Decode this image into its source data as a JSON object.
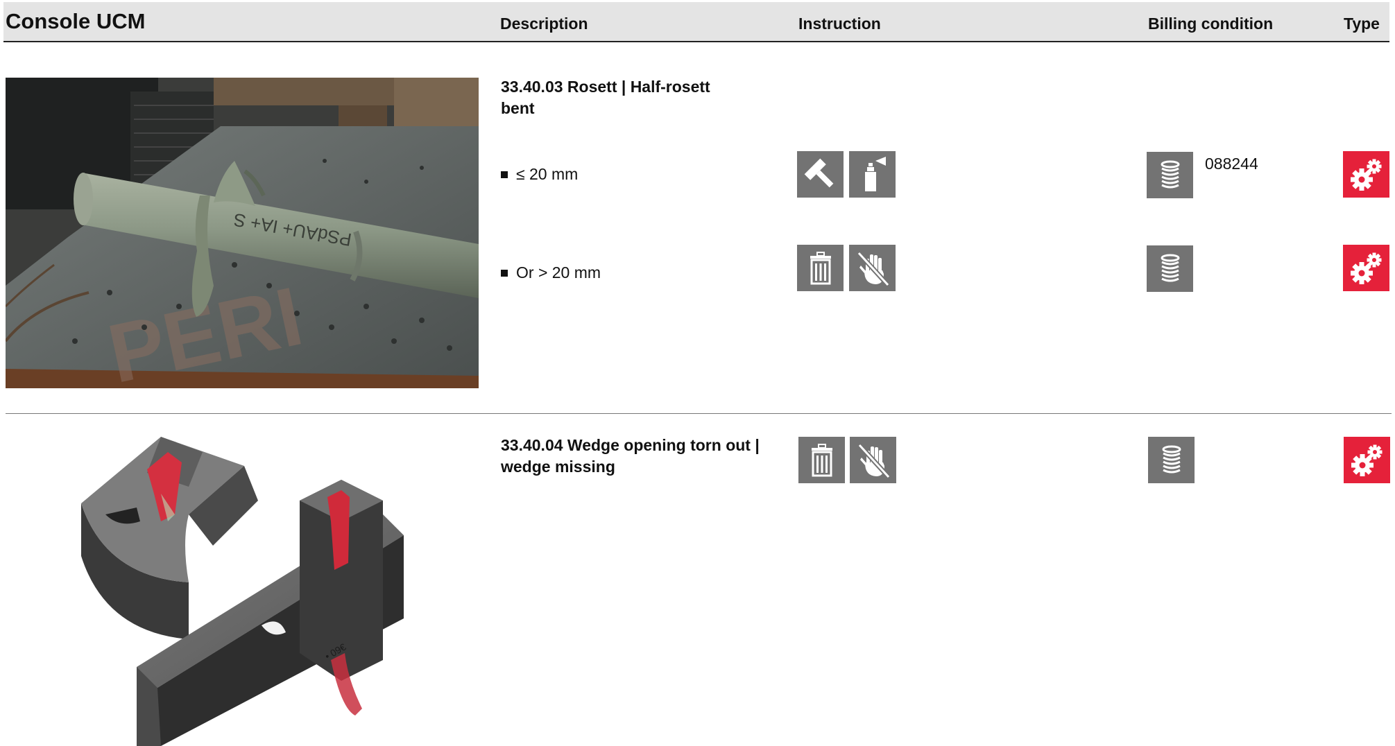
{
  "header": {
    "title": "Console UCM",
    "columns": {
      "description": "Description",
      "instruction": "Instruction",
      "billing": "Billing condition",
      "type": "Type"
    }
  },
  "entries": [
    {
      "title": "33.40.03 Rosett | Half-rosett bent",
      "image": "bent-rosette-photo",
      "conditions": [
        {
          "text": "≤ 20 mm",
          "instructions": [
            "hammer-icon",
            "spray-can-icon"
          ],
          "billing_icon": "coin-stack-icon",
          "billing_code": "088244",
          "type_icon": "gears-icon"
        },
        {
          "text": "Or > 20 mm",
          "instructions": [
            "trash-icon",
            "no-hand-icon"
          ],
          "billing_icon": "coin-stack-icon",
          "billing_code": "",
          "type_icon": "gears-icon"
        }
      ]
    },
    {
      "title": "33.40.04 Wedge opening torn out | wedge missing",
      "image": "wedge-render",
      "instructions": [
        "trash-icon",
        "no-hand-icon"
      ],
      "billing_icon": "coin-stack-icon",
      "type_icon": "gears-icon"
    }
  ],
  "colors": {
    "header_bg": "#e4e4e4",
    "icon_gray": "#737373",
    "icon_red": "#e5213a"
  }
}
